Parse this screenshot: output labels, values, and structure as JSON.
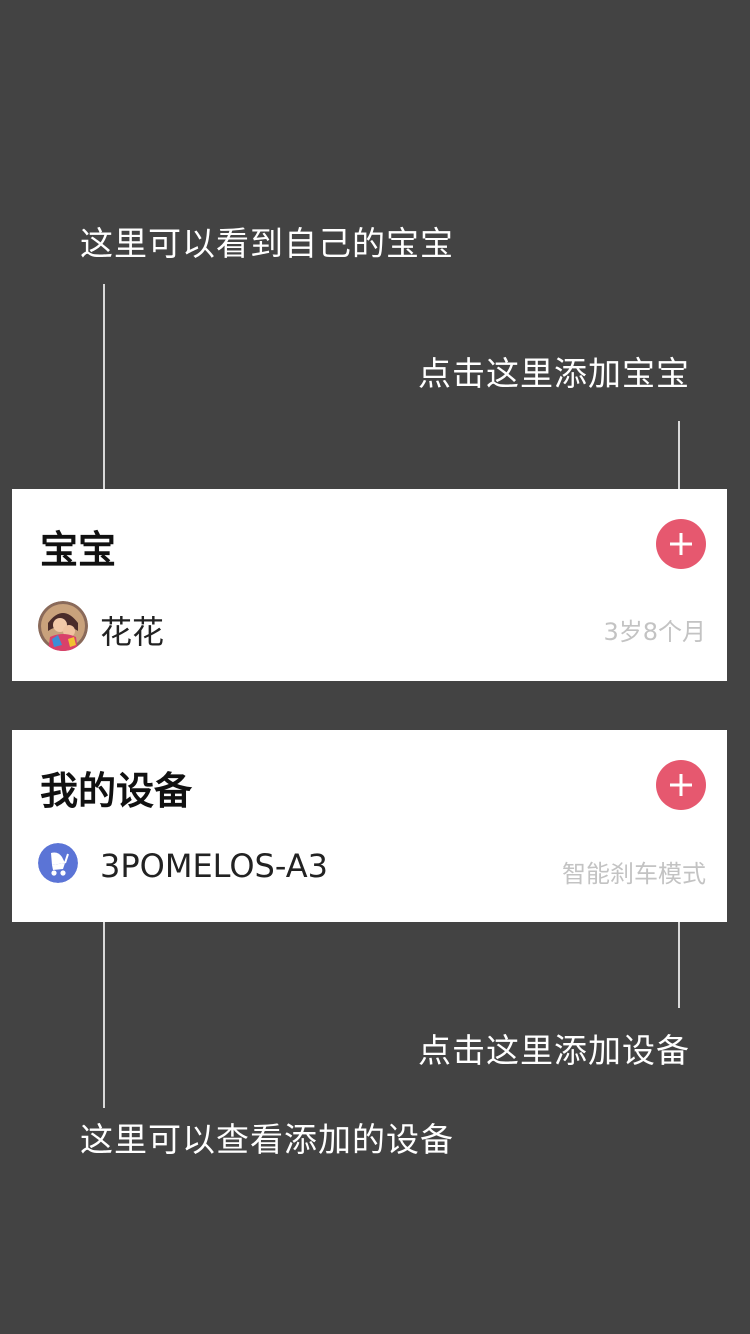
{
  "annotations": {
    "view_baby": "这里可以看到自己的宝宝",
    "add_baby": "点击这里添加宝宝",
    "add_device": "点击这里添加设备",
    "view_devices": "这里可以查看添加的设备"
  },
  "baby_card": {
    "title": "宝宝",
    "add_icon": "plus-icon",
    "baby": {
      "name": "花花",
      "age": "3岁8个月",
      "avatar": "baby-avatar"
    }
  },
  "device_card": {
    "title": "我的设备",
    "add_icon": "plus-icon",
    "device": {
      "name": "3POMELOS-A3",
      "mode": "智能刹车模式",
      "icon": "stroller-icon"
    }
  },
  "colors": {
    "background": "#434343",
    "card": "#ffffff",
    "accent": "#e6586f",
    "device_icon": "#5b74d6"
  }
}
